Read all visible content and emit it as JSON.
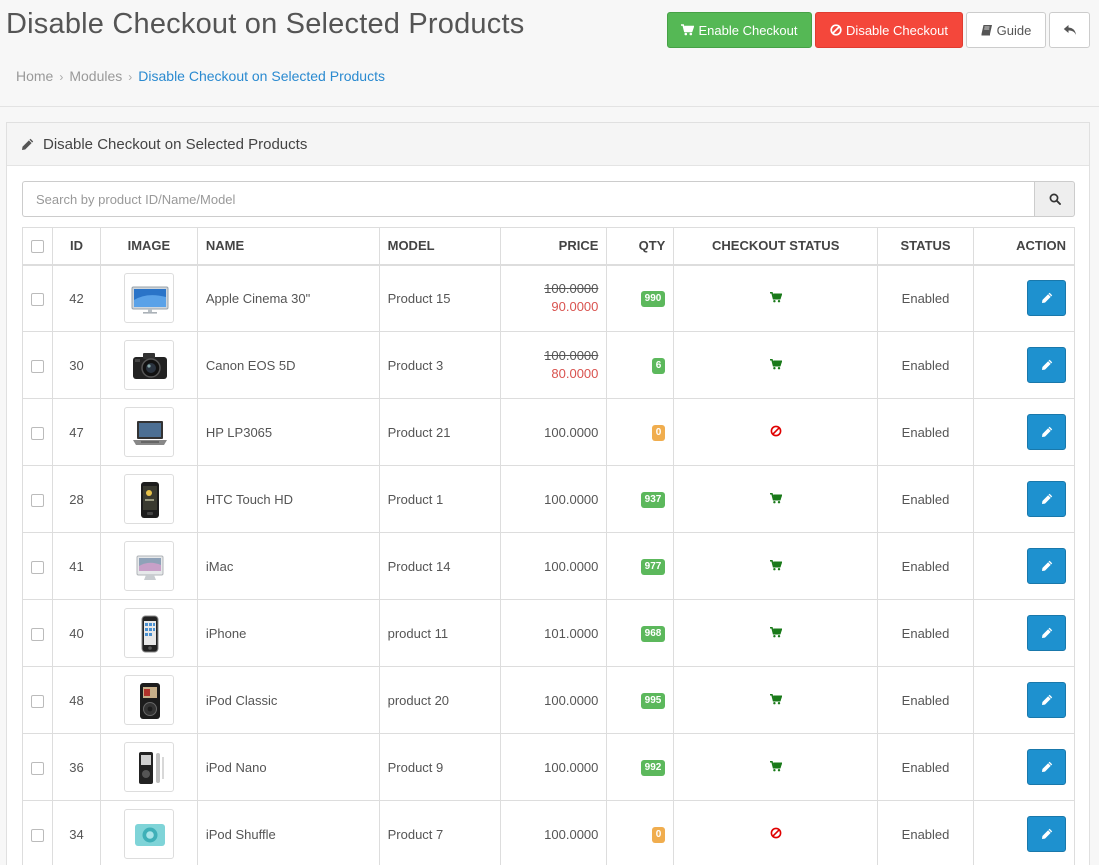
{
  "page": {
    "title": "Disable Checkout on Selected Products"
  },
  "toolbar": {
    "enable_label": "Enable Checkout",
    "disable_label": "Disable Checkout",
    "guide_label": "Guide"
  },
  "breadcrumb": [
    "Home",
    "Modules",
    "Disable Checkout on Selected Products"
  ],
  "panel": {
    "title": "Disable Checkout on Selected Products"
  },
  "search": {
    "placeholder": "Search by product ID/Name/Model",
    "value": ""
  },
  "table": {
    "columns": [
      "ID",
      "IMAGE",
      "NAME",
      "MODEL",
      "PRICE",
      "QTY",
      "CHECKOUT STATUS",
      "STATUS",
      "ACTION"
    ],
    "rows": [
      {
        "id": "42",
        "image": "monitor",
        "name": "Apple Cinema 30\"",
        "model": "Product 15",
        "price": "100.0000",
        "special": "90.0000",
        "qty": "990",
        "qty_level": "success",
        "checkout": "enabled",
        "status": "Enabled"
      },
      {
        "id": "30",
        "image": "camera",
        "name": "Canon EOS 5D",
        "model": "Product 3",
        "price": "100.0000",
        "special": "80.0000",
        "qty": "6",
        "qty_level": "success",
        "checkout": "enabled",
        "status": "Enabled"
      },
      {
        "id": "47",
        "image": "laptop",
        "name": "HP LP3065",
        "model": "Product 21",
        "price": "100.0000",
        "special": "",
        "qty": "0",
        "qty_level": "warning",
        "checkout": "disabled",
        "status": "Enabled"
      },
      {
        "id": "28",
        "image": "phone-dark",
        "name": "HTC Touch HD",
        "model": "Product 1",
        "price": "100.0000",
        "special": "",
        "qty": "937",
        "qty_level": "success",
        "checkout": "enabled",
        "status": "Enabled"
      },
      {
        "id": "41",
        "image": "imac",
        "name": "iMac",
        "model": "Product 14",
        "price": "100.0000",
        "special": "",
        "qty": "977",
        "qty_level": "success",
        "checkout": "enabled",
        "status": "Enabled"
      },
      {
        "id": "40",
        "image": "iphone",
        "name": "iPhone",
        "model": "product 11",
        "price": "101.0000",
        "special": "",
        "qty": "968",
        "qty_level": "success",
        "checkout": "enabled",
        "status": "Enabled"
      },
      {
        "id": "48",
        "image": "ipod-classic",
        "name": "iPod Classic",
        "model": "product 20",
        "price": "100.0000",
        "special": "",
        "qty": "995",
        "qty_level": "success",
        "checkout": "enabled",
        "status": "Enabled"
      },
      {
        "id": "36",
        "image": "ipod-nano",
        "name": "iPod Nano",
        "model": "Product 9",
        "price": "100.0000",
        "special": "",
        "qty": "992",
        "qty_level": "success",
        "checkout": "enabled",
        "status": "Enabled"
      },
      {
        "id": "34",
        "image": "ipod-shuffle",
        "name": "iPod Shuffle",
        "model": "Product 7",
        "price": "100.0000",
        "special": "",
        "qty": "0",
        "qty_level": "warning",
        "checkout": "disabled",
        "status": "Enabled"
      }
    ]
  },
  "colors": {
    "success": "#5cb85c",
    "danger": "#f4473b",
    "primary": "#1e91cf",
    "cart_icon": "#1a7a1a",
    "ban_icon": "#e00000"
  },
  "icons": {
    "enable": "cart-icon",
    "disable": "ban-icon",
    "guide": "book-icon",
    "back": "reply-icon",
    "panel": "pencil-icon",
    "search": "search-icon",
    "edit": "pencil-icon"
  }
}
